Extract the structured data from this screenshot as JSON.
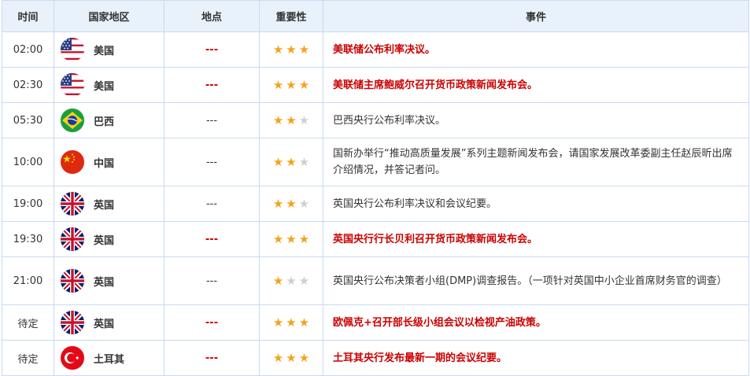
{
  "headers": {
    "time": "时间",
    "country": "国家地区",
    "location": "地点",
    "importance": "重要性",
    "event": "事件"
  },
  "colors": {
    "highlight": "#cc0000",
    "star_on": "#f4a21c",
    "star_off": "#cfcfcf",
    "header_bg": "#e9f1fb",
    "border": "#c9daf0"
  },
  "rows": [
    {
      "time": "02:00",
      "flag": "us-flag-icon",
      "country": "美国",
      "location": "---",
      "stars": 3,
      "event": "美联储公布利率决议。",
      "highlight": true
    },
    {
      "time": "02:30",
      "flag": "us-flag-icon",
      "country": "美国",
      "location": "---",
      "stars": 3,
      "event": "美联储主席鲍威尔召开货币政策新闻发布会。",
      "highlight": true
    },
    {
      "time": "05:30",
      "flag": "br-flag-icon",
      "country": "巴西",
      "location": "---",
      "stars": 2,
      "event": "巴西央行公布利率决议。",
      "highlight": false
    },
    {
      "time": "10:00",
      "flag": "cn-flag-icon",
      "country": "中国",
      "location": "---",
      "stars": 2,
      "event": "国新办举行“推动高质量发展”系列主题新闻发布会，请国家发展改革委副主任赵辰昕出席介绍情况，并答记者问。",
      "highlight": false
    },
    {
      "time": "19:00",
      "flag": "uk-flag-icon",
      "country": "英国",
      "location": "---",
      "stars": 2,
      "event": "英国央行公布利率决议和会议纪要。",
      "highlight": false
    },
    {
      "time": "19:30",
      "flag": "uk-flag-icon",
      "country": "英国",
      "location": "---",
      "stars": 3,
      "event": "英国央行行长贝利召开货币政策新闻发布会。",
      "highlight": true
    },
    {
      "time": "21:00",
      "flag": "uk-flag-icon",
      "country": "英国",
      "location": "---",
      "stars": 1,
      "event": "英国央行公布决策者小组(DMP)调查报告。（一项针对英国中小企业首席财务官的调查）",
      "highlight": false
    },
    {
      "time": "待定",
      "flag": "uk-flag-icon",
      "country": "英国",
      "location": "---",
      "stars": 3,
      "event": "欧佩克+召开部长级小组会议以检视产油政策。",
      "highlight": true
    },
    {
      "time": "待定",
      "flag": "tr-flag-icon",
      "country": "土耳其",
      "location": "---",
      "stars": 3,
      "event": "土耳其央行发布最新一期的会议纪要。",
      "highlight": true
    }
  ]
}
